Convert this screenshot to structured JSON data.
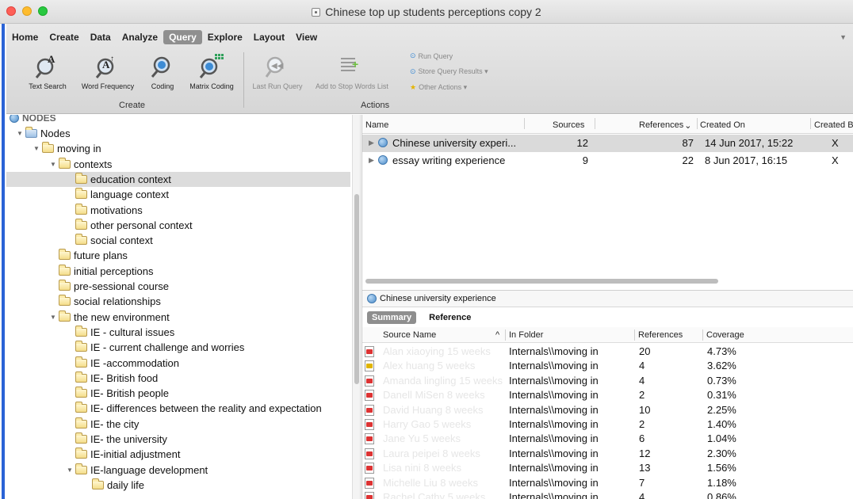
{
  "window": {
    "title": "Chinese top up students perceptions copy 2",
    "traffic_lights": [
      "#fe5f57",
      "#febc2e",
      "#28c840"
    ]
  },
  "ribbon": {
    "tabs": [
      "Home",
      "Create",
      "Data",
      "Analyze",
      "Query",
      "Explore",
      "Layout",
      "View"
    ],
    "active_tab": "Query",
    "create_buttons": [
      {
        "label": "Text Search",
        "icon": "text-search-icon"
      },
      {
        "label": "Word Frequency",
        "icon": "word-frequency-icon"
      },
      {
        "label": "Coding",
        "icon": "coding-query-icon"
      },
      {
        "label": "Matrix Coding",
        "icon": "matrix-coding-icon"
      }
    ],
    "create_group_label": "Create",
    "action_buttons": [
      {
        "label": "Last Run Query",
        "icon": "last-run-query-icon"
      },
      {
        "label": "Add to Stop Words List",
        "icon": "add-stop-words-icon"
      }
    ],
    "small_actions": [
      "Run Query",
      "Store Query Results ▾",
      "Other Actions ▾"
    ],
    "actions_group_label": "Actions"
  },
  "tree": {
    "header": "NODES",
    "items": [
      {
        "label": "Nodes",
        "level": 0,
        "expanded": true,
        "kind": "nodes-root"
      },
      {
        "label": "moving in",
        "level": 1,
        "expanded": true,
        "kind": "folder"
      },
      {
        "label": "contexts",
        "level": 2,
        "expanded": true,
        "kind": "folder"
      },
      {
        "label": "education context",
        "level": 3,
        "kind": "folder",
        "selected": true
      },
      {
        "label": "language context",
        "level": 3,
        "kind": "folder"
      },
      {
        "label": "motivations",
        "level": 3,
        "kind": "folder"
      },
      {
        "label": "other personal context",
        "level": 3,
        "kind": "folder"
      },
      {
        "label": "social context",
        "level": 3,
        "kind": "folder"
      },
      {
        "label": "future plans",
        "level": 2,
        "kind": "folder"
      },
      {
        "label": "initial perceptions",
        "level": 2,
        "kind": "folder"
      },
      {
        "label": "pre-sessional course",
        "level": 2,
        "kind": "folder"
      },
      {
        "label": "social relationships",
        "level": 2,
        "kind": "folder"
      },
      {
        "label": "the new environment",
        "level": 2,
        "expanded": true,
        "kind": "folder"
      },
      {
        "label": "IE - cultural issues",
        "level": 3,
        "kind": "folder"
      },
      {
        "label": "IE - current challenge and worries",
        "level": 3,
        "kind": "folder"
      },
      {
        "label": "IE -accommodation",
        "level": 3,
        "kind": "folder"
      },
      {
        "label": "IE- British food",
        "level": 3,
        "kind": "folder"
      },
      {
        "label": "IE- British people",
        "level": 3,
        "kind": "folder"
      },
      {
        "label": "IE- differences between the reality and expectation",
        "level": 3,
        "kind": "folder"
      },
      {
        "label": "IE- the city",
        "level": 3,
        "kind": "folder"
      },
      {
        "label": "IE- the university",
        "level": 3,
        "kind": "folder"
      },
      {
        "label": "IE-initial adjustment",
        "level": 3,
        "kind": "folder"
      },
      {
        "label": "IE-language development",
        "level": 3,
        "expanded": true,
        "kind": "folder"
      },
      {
        "label": "daily life",
        "level": 4,
        "kind": "folder"
      }
    ]
  },
  "query_list": {
    "columns": [
      "Name",
      "Sources",
      "References",
      "Created On",
      "Created B"
    ],
    "sort_indicator": "⌄",
    "rows": [
      {
        "name": "Chinese university experi...",
        "sources": "12",
        "references": "87",
        "created_on": "14 Jun 2017, 15:22",
        "created_by": "X",
        "selected": true
      },
      {
        "name": "essay writing experience",
        "sources": "9",
        "references": "22",
        "created_on": "8 Jun 2017, 16:15",
        "created_by": "X"
      }
    ]
  },
  "detail": {
    "title": "Chinese university experience",
    "tabs": [
      "Summary",
      "Reference"
    ],
    "active_tab": "Summary",
    "columns": [
      "Source Name",
      "In Folder",
      "References",
      "Coverage"
    ],
    "sort_arrow": "^",
    "rows": [
      {
        "source": "Alan xiaoying 15 weeks",
        "folder": "Internals\\\\moving in",
        "refs": "20",
        "coverage": "4.73%",
        "type": "pdf"
      },
      {
        "source": "Alex huang 5 weeks",
        "folder": "Internals\\\\moving in",
        "refs": "4",
        "coverage": "3.62%",
        "type": "doc"
      },
      {
        "source": "Amanda lingling 15 weeks",
        "folder": "Internals\\\\moving in",
        "refs": "4",
        "coverage": "0.73%",
        "type": "pdf"
      },
      {
        "source": "Danell MiSen 8 weeks",
        "folder": "Internals\\\\moving in",
        "refs": "2",
        "coverage": "0.31%",
        "type": "pdf"
      },
      {
        "source": "David Huang 8 weeks",
        "folder": "Internals\\\\moving in",
        "refs": "10",
        "coverage": "2.25%",
        "type": "pdf"
      },
      {
        "source": "Harry Gao 5 weeks",
        "folder": "Internals\\\\moving in",
        "refs": "2",
        "coverage": "1.40%",
        "type": "pdf"
      },
      {
        "source": "Jane Yu 5 weeks",
        "folder": "Internals\\\\moving in",
        "refs": "6",
        "coverage": "1.04%",
        "type": "pdf"
      },
      {
        "source": "Laura peipei 8 weeks",
        "folder": "Internals\\\\moving in",
        "refs": "12",
        "coverage": "2.30%",
        "type": "pdf"
      },
      {
        "source": "Lisa nini 8 weeks",
        "folder": "Internals\\\\moving in",
        "refs": "13",
        "coverage": "1.56%",
        "type": "pdf"
      },
      {
        "source": "Michelle Liu 8 weeks",
        "folder": "Internals\\\\moving in",
        "refs": "7",
        "coverage": "1.18%",
        "type": "pdf"
      },
      {
        "source": "Rachel Cathy 5 weeks",
        "folder": "Internals\\\\moving in",
        "refs": "4",
        "coverage": "0.86%",
        "type": "pdf"
      }
    ]
  }
}
